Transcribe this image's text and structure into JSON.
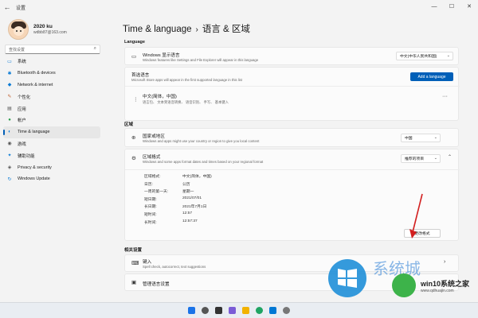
{
  "window": {
    "title": "设置",
    "back_glyph": "←",
    "controls": [
      "—",
      "☐",
      "✕"
    ]
  },
  "user": {
    "name": "2020 ku",
    "email": "wdbb87@163.com"
  },
  "search": {
    "placeholder": "查找设置"
  },
  "nav": [
    {
      "label": "系统",
      "icon": "monitor-icon",
      "color": "#0a7bd5"
    },
    {
      "label": "Bluetooth & devices",
      "icon": "bluetooth-icon",
      "color": "#0a7bd5"
    },
    {
      "label": "Network & internet",
      "icon": "wifi-icon",
      "color": "#0a7bd5"
    },
    {
      "label": "个性化",
      "icon": "brush-icon",
      "color": "#c06030"
    },
    {
      "label": "应用",
      "icon": "apps-icon",
      "color": "#555"
    },
    {
      "label": "帐户",
      "icon": "person-icon",
      "color": "#2a9d4b"
    },
    {
      "label": "Time & language",
      "icon": "globe-clock-icon",
      "color": "#0a7bd5",
      "active": true
    },
    {
      "label": "游戏",
      "icon": "gamepad-icon",
      "color": "#555"
    },
    {
      "label": "辅助功能",
      "icon": "accessibility-icon",
      "color": "#0a7bd5"
    },
    {
      "label": "Privacy & security",
      "icon": "shield-icon",
      "color": "#555"
    },
    {
      "label": "Windows Update",
      "icon": "update-icon",
      "color": "#0a7bd5"
    }
  ],
  "breadcrumb": {
    "parent": "Time & language",
    "separator": "›",
    "current": "语言 & 区域"
  },
  "language_section": {
    "label": "Language",
    "display_language": {
      "title": "Windows 显示语言",
      "subtitle": "Windows features like Settings and File Explorer will appear in this language",
      "value": "中文(中华人民共和国)"
    },
    "preferred": {
      "title": "首选语言",
      "subtitle": "Microsoft Store apps will appear in the first supported language in this list",
      "button": "Add a language"
    },
    "lang_item": {
      "title": "中文(简体，中国)",
      "subtitle": "语言包、 文本到语音转换、 语音识别、 手写、 基本键入"
    }
  },
  "region_section": {
    "label": "区域",
    "country": {
      "title": "国家或地区",
      "subtitle": "Windows and apps might use your country or region to give you local content",
      "value": "中国"
    },
    "format": {
      "title": "区域格式",
      "subtitle": "Windows and some apps format dates and times based on your regional format",
      "value": "推荐的项目"
    },
    "details": [
      {
        "k": "区域格式:",
        "v": "中文(简体，中国)"
      },
      {
        "k": "日历:",
        "v": "公历"
      },
      {
        "k": "一周的第一天:",
        "v": "星期一"
      },
      {
        "k": "短日期:",
        "v": "2021/07/01"
      },
      {
        "k": "长日期:",
        "v": "2021年7月1日"
      },
      {
        "k": "短时间:",
        "v": "12:57"
      },
      {
        "k": "长时间:",
        "v": "12:57:37"
      }
    ],
    "change_button": "更改格式"
  },
  "related_section": {
    "label": "相关设置",
    "typing": {
      "title": "键入",
      "subtitle": "Spell check, autocorrect, text suggestions"
    },
    "admin": {
      "title": "管理语言设置"
    }
  },
  "watermark": {
    "text": "系统城",
    "brand": "win10系统之家",
    "url": "www.qdhuajin.com"
  }
}
